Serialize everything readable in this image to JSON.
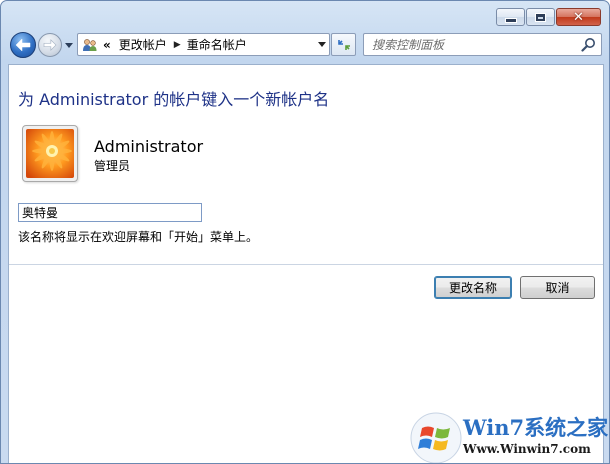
{
  "navigation": {
    "breadcrumb_overflow": "«",
    "breadcrumb": [
      "更改帐户",
      "重命名帐户"
    ]
  },
  "search": {
    "placeholder": "搜索控制面板"
  },
  "page": {
    "heading": "为 Administrator 的帐户键入一个新帐户名",
    "user_name": "Administrator",
    "user_role": "管理员",
    "new_name_value": "奥特曼",
    "hint": "该名称将显示在欢迎屏幕和「开始」菜单上。"
  },
  "buttons": {
    "rename": "更改名称",
    "cancel": "取消"
  },
  "watermark": {
    "title": "Win7系统之家",
    "url": "Www.Winwin7.com"
  },
  "icons": {
    "back": "back-arrow-icon",
    "forward": "forward-arrow-icon",
    "address": "users-icon",
    "refresh": "refresh-icon",
    "search": "search-icon",
    "avatar": "flower-avatar",
    "watermark": "windows-logo"
  }
}
